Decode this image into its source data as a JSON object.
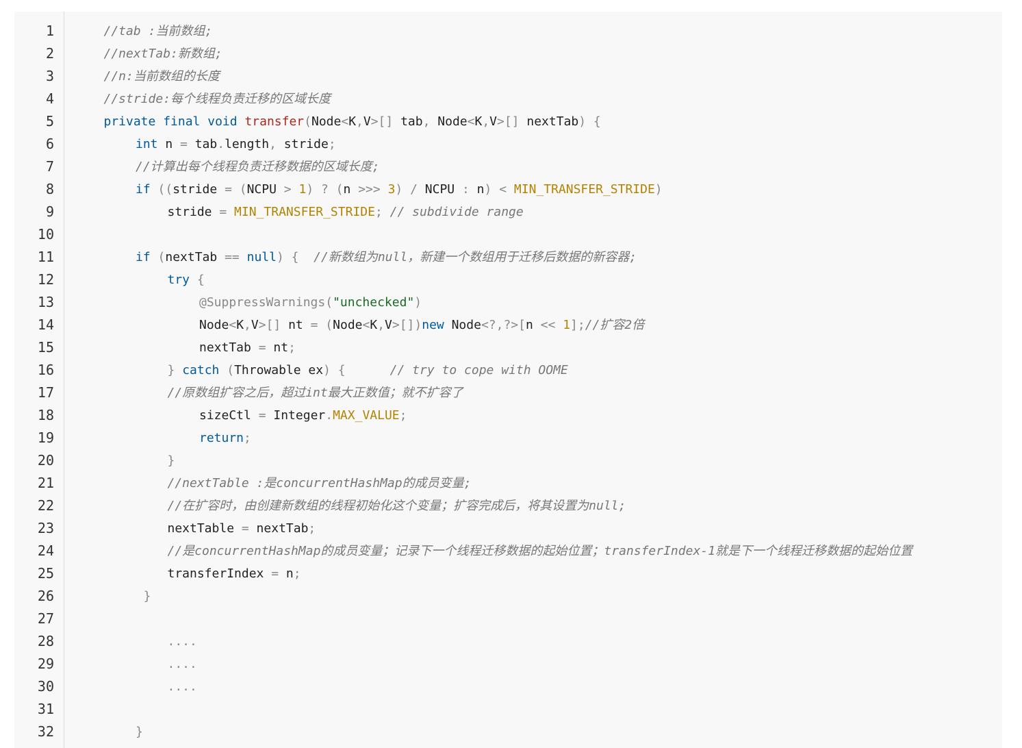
{
  "line_numbers": [
    "1",
    "2",
    "3",
    "4",
    "5",
    "6",
    "7",
    "8",
    "9",
    "10",
    "11",
    "12",
    "13",
    "14",
    "15",
    "16",
    "17",
    "18",
    "19",
    "20",
    "21",
    "22",
    "23",
    "24",
    "25",
    "26",
    "27",
    "28",
    "29",
    "30",
    "31",
    "32"
  ],
  "lines": [
    {
      "indent": 1,
      "tokens": [
        [
          "cm",
          "//tab :当前数组;"
        ]
      ]
    },
    {
      "indent": 1,
      "tokens": [
        [
          "cm",
          "//nextTab:新数组;"
        ]
      ]
    },
    {
      "indent": 1,
      "tokens": [
        [
          "cm",
          "//n:当前数组的长度"
        ]
      ]
    },
    {
      "indent": 1,
      "tokens": [
        [
          "cm",
          "//stride:每个线程负责迁移的区域长度"
        ]
      ]
    },
    {
      "indent": 1,
      "tokens": [
        [
          "kw",
          "private"
        ],
        [
          "pl",
          " "
        ],
        [
          "kw",
          "final"
        ],
        [
          "pl",
          " "
        ],
        [
          "kw",
          "void"
        ],
        [
          "pl",
          " "
        ],
        [
          "fn",
          "transfer"
        ],
        [
          "op",
          "("
        ],
        [
          "pl",
          "Node"
        ],
        [
          "op",
          "<"
        ],
        [
          "pl",
          "K"
        ],
        [
          "op",
          ","
        ],
        [
          "pl",
          "V"
        ],
        [
          "op",
          ">[]"
        ],
        [
          "pl",
          " tab"
        ],
        [
          "op",
          ","
        ],
        [
          "pl",
          " Node"
        ],
        [
          "op",
          "<"
        ],
        [
          "pl",
          "K"
        ],
        [
          "op",
          ","
        ],
        [
          "pl",
          "V"
        ],
        [
          "op",
          ">[]"
        ],
        [
          "pl",
          " nextTab"
        ],
        [
          "op",
          ") {"
        ]
      ]
    },
    {
      "indent": 2,
      "tokens": [
        [
          "kw",
          "int"
        ],
        [
          "pl",
          " n "
        ],
        [
          "op",
          "="
        ],
        [
          "pl",
          " tab"
        ],
        [
          "op",
          "."
        ],
        [
          "pl",
          "length"
        ],
        [
          "op",
          ","
        ],
        [
          "pl",
          " stride"
        ],
        [
          "op",
          ";"
        ]
      ]
    },
    {
      "indent": 2,
      "tokens": [
        [
          "cm",
          "//计算出每个线程负责迁移数据的区域长度;"
        ]
      ]
    },
    {
      "indent": 2,
      "tokens": [
        [
          "kw",
          "if"
        ],
        [
          "op",
          " (("
        ],
        [
          "pl",
          "stride "
        ],
        [
          "op",
          "="
        ],
        [
          "op",
          " ("
        ],
        [
          "pl",
          "NCPU "
        ],
        [
          "op",
          ">"
        ],
        [
          "pl",
          " "
        ],
        [
          "cst",
          "1"
        ],
        [
          "op",
          ")"
        ],
        [
          "pl",
          " "
        ],
        [
          "op",
          "?"
        ],
        [
          "op",
          " ("
        ],
        [
          "pl",
          "n "
        ],
        [
          "op",
          ">>>"
        ],
        [
          "pl",
          " "
        ],
        [
          "cst",
          "3"
        ],
        [
          "op",
          ")"
        ],
        [
          "pl",
          " "
        ],
        [
          "op",
          "/"
        ],
        [
          "pl",
          " NCPU "
        ],
        [
          "op",
          ":"
        ],
        [
          "pl",
          " n"
        ],
        [
          "op",
          ")"
        ],
        [
          "pl",
          " "
        ],
        [
          "op",
          "<"
        ],
        [
          "pl",
          " "
        ],
        [
          "cst",
          "MIN_TRANSFER_STRIDE"
        ],
        [
          "op",
          ")"
        ]
      ]
    },
    {
      "indent": 3,
      "tokens": [
        [
          "pl",
          "stride "
        ],
        [
          "op",
          "="
        ],
        [
          "pl",
          " "
        ],
        [
          "cst",
          "MIN_TRANSFER_STRIDE"
        ],
        [
          "op",
          ";"
        ],
        [
          "pl",
          " "
        ],
        [
          "cm",
          "// subdivide range"
        ]
      ]
    },
    {
      "indent": 0,
      "tokens": []
    },
    {
      "indent": 2,
      "tokens": [
        [
          "kw",
          "if"
        ],
        [
          "op",
          " ("
        ],
        [
          "pl",
          "nextTab "
        ],
        [
          "op",
          "=="
        ],
        [
          "pl",
          " "
        ],
        [
          "kw",
          "null"
        ],
        [
          "op",
          ") {"
        ],
        [
          "pl",
          "  "
        ],
        [
          "cm",
          "//新数组为null，新建一个数组用于迁移后数据的新容器;"
        ]
      ]
    },
    {
      "indent": 3,
      "tokens": [
        [
          "kw",
          "try"
        ],
        [
          "op",
          " {"
        ]
      ]
    },
    {
      "indent": 4,
      "tokens": [
        [
          "an",
          "@SuppressWarnings"
        ],
        [
          "op",
          "("
        ],
        [
          "str",
          "\"unchecked\""
        ],
        [
          "op",
          ")"
        ]
      ]
    },
    {
      "indent": 4,
      "tokens": [
        [
          "pl",
          "Node"
        ],
        [
          "op",
          "<"
        ],
        [
          "pl",
          "K"
        ],
        [
          "op",
          ","
        ],
        [
          "pl",
          "V"
        ],
        [
          "op",
          ">[]"
        ],
        [
          "pl",
          " nt "
        ],
        [
          "op",
          "="
        ],
        [
          "op",
          " ("
        ],
        [
          "pl",
          "Node"
        ],
        [
          "op",
          "<"
        ],
        [
          "pl",
          "K"
        ],
        [
          "op",
          ","
        ],
        [
          "pl",
          "V"
        ],
        [
          "op",
          ">[])"
        ],
        [
          "kw",
          "new"
        ],
        [
          "pl",
          " Node"
        ],
        [
          "op",
          "<?,?>["
        ],
        [
          "pl",
          "n "
        ],
        [
          "op",
          "<<"
        ],
        [
          "pl",
          " "
        ],
        [
          "cst",
          "1"
        ],
        [
          "op",
          "];"
        ],
        [
          "cm",
          "//扩容2倍"
        ]
      ]
    },
    {
      "indent": 4,
      "tokens": [
        [
          "pl",
          "nextTab "
        ],
        [
          "op",
          "="
        ],
        [
          "pl",
          " nt"
        ],
        [
          "op",
          ";"
        ]
      ]
    },
    {
      "indent": 3,
      "tokens": [
        [
          "op",
          "}"
        ],
        [
          "pl",
          " "
        ],
        [
          "kw",
          "catch"
        ],
        [
          "op",
          " ("
        ],
        [
          "pl",
          "Throwable ex"
        ],
        [
          "op",
          ") {"
        ],
        [
          "pl",
          "      "
        ],
        [
          "cm",
          "// try to cope with OOME"
        ]
      ]
    },
    {
      "indent": 3,
      "tokens": [
        [
          "cm",
          "//原数组扩容之后，超过int最大正数值；就不扩容了"
        ]
      ]
    },
    {
      "indent": 4,
      "tokens": [
        [
          "pl",
          "sizeCtl "
        ],
        [
          "op",
          "="
        ],
        [
          "pl",
          " Integer"
        ],
        [
          "op",
          "."
        ],
        [
          "cst",
          "MAX_VALUE"
        ],
        [
          "op",
          ";"
        ]
      ]
    },
    {
      "indent": 4,
      "tokens": [
        [
          "kw",
          "return"
        ],
        [
          "op",
          ";"
        ]
      ]
    },
    {
      "indent": 3,
      "tokens": [
        [
          "op",
          "}"
        ]
      ]
    },
    {
      "indent": 3,
      "tokens": [
        [
          "cm",
          "//nextTable :是concurrentHashMap的成员变量;"
        ]
      ]
    },
    {
      "indent": 3,
      "tokens": [
        [
          "cm",
          "//在扩容时，由创建新数组的线程初始化这个变量；扩容完成后，将其设置为null;"
        ]
      ]
    },
    {
      "indent": 3,
      "tokens": [
        [
          "pl",
          "nextTable "
        ],
        [
          "op",
          "="
        ],
        [
          "pl",
          " nextTab"
        ],
        [
          "op",
          ";"
        ]
      ]
    },
    {
      "indent": 3,
      "tokens": [
        [
          "cm",
          "//是concurrentHashMap的成员变量；记录下一个线程迁移数据的起始位置；transferIndex-1就是下一个线程迁移数据的起始位置"
        ]
      ]
    },
    {
      "indent": 3,
      "tokens": [
        [
          "pl",
          "transferIndex "
        ],
        [
          "op",
          "="
        ],
        [
          "pl",
          " n"
        ],
        [
          "op",
          ";"
        ]
      ]
    },
    {
      "indent": 2.25,
      "tokens": [
        [
          "op",
          "}"
        ]
      ]
    },
    {
      "indent": 0,
      "tokens": []
    },
    {
      "indent": 3,
      "tokens": [
        [
          "op",
          "...."
        ]
      ]
    },
    {
      "indent": 3,
      "tokens": [
        [
          "op",
          "...."
        ]
      ]
    },
    {
      "indent": 3,
      "tokens": [
        [
          "op",
          "...."
        ]
      ]
    },
    {
      "indent": 0,
      "tokens": []
    },
    {
      "indent": 2,
      "tokens": [
        [
          "op",
          "}"
        ]
      ]
    }
  ]
}
